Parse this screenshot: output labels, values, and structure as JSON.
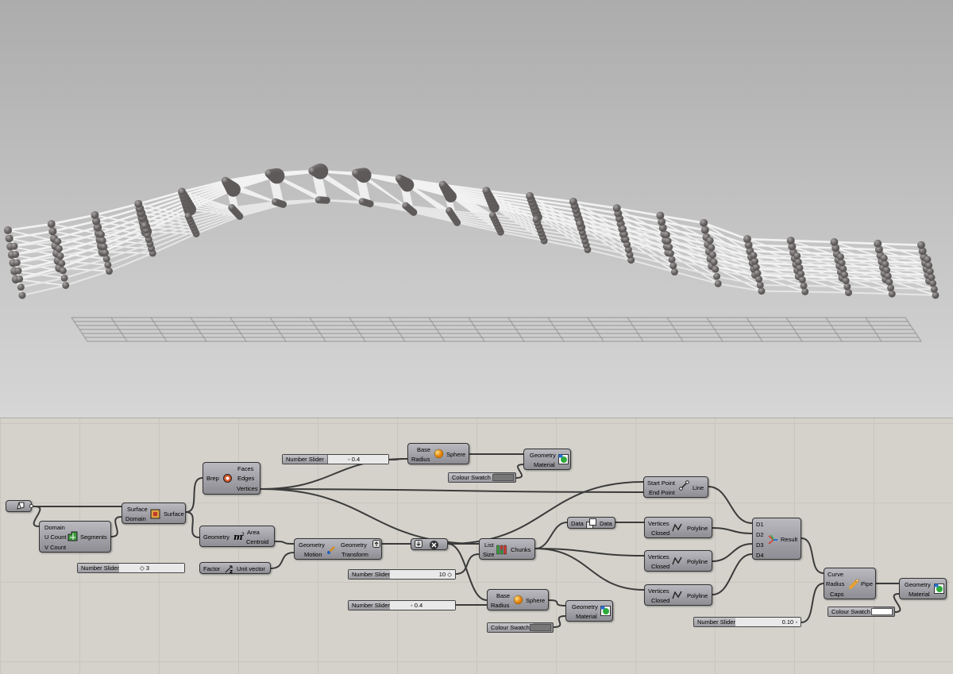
{
  "colors": {
    "wire": "#444444",
    "node_fill": "#a3a3a9",
    "sphere": "#7b7777",
    "pipe": "#f2f2f2"
  },
  "nodes": {
    "brep": {
      "in": [
        "Brep"
      ],
      "out": [
        "Faces",
        "Edges",
        "Vertices"
      ]
    },
    "surface": {
      "in": [
        "Surface",
        "Domain"
      ],
      "out": [
        "Surface"
      ]
    },
    "segments": {
      "in": [
        "Domain",
        "U Count",
        "V Count"
      ],
      "out": [
        "Segments"
      ]
    },
    "area": {
      "in": [
        "Geometry"
      ],
      "out": [
        "Area",
        "Centroid"
      ]
    },
    "unit_vector": {
      "in": [
        "Factor"
      ],
      "out": [
        "Unit vector"
      ]
    },
    "move": {
      "in": [
        "Geometry",
        "Motion"
      ],
      "out": [
        "Geometry",
        "Transform"
      ]
    },
    "sphere_top": {
      "in": [
        "Base",
        "Radius"
      ],
      "out": [
        "Sphere"
      ]
    },
    "sphere_bottom": {
      "in": [
        "Base",
        "Radius"
      ],
      "out": [
        "Sphere"
      ]
    },
    "preview_top": {
      "in": [
        "Geometry",
        "Material"
      ]
    },
    "preview_bottom": {
      "in": [
        "Geometry",
        "Material"
      ]
    },
    "preview_right": {
      "in": [
        "Geometry",
        "Material"
      ]
    },
    "line": {
      "in": [
        "Start Point",
        "End Point"
      ],
      "out": [
        "Line"
      ]
    },
    "chunks": {
      "in": [
        "List",
        "Size"
      ],
      "out": [
        "Chunks"
      ]
    },
    "data": {
      "in": [
        "Data"
      ],
      "out": [
        "Data"
      ]
    },
    "polyline1": {
      "in": [
        "Vertices",
        "Closed"
      ],
      "out": [
        "Polyline"
      ]
    },
    "polyline2": {
      "in": [
        "Vertices",
        "Closed"
      ],
      "out": [
        "Polyline"
      ]
    },
    "polyline3": {
      "in": [
        "Vertices",
        "Closed"
      ],
      "out": [
        "Polyline"
      ]
    },
    "merge": {
      "in": [
        "D1",
        "D2",
        "D3",
        "D4"
      ],
      "out": [
        "Result"
      ]
    },
    "pipe": {
      "in": [
        "Curve",
        "Radius",
        "Caps"
      ],
      "out": [
        "Pipe"
      ]
    }
  },
  "sliders": {
    "radius_top": {
      "name": "Number Slider",
      "value": "0.4"
    },
    "factor": {
      "name": "Number Slider",
      "value": "3"
    },
    "chunk_size": {
      "name": "Number Slider",
      "value": "10"
    },
    "radius_bottom": {
      "name": "Number Slider",
      "value": "0.4"
    },
    "pipe_radius": {
      "name": "Number Slider",
      "value": "0.10"
    }
  },
  "swatches": {
    "top": {
      "name": "Colour Swatch",
      "color": "#777777"
    },
    "bottom": {
      "name": "Colour Swatch",
      "color": "#777777"
    },
    "right": {
      "name": "Colour Swatch",
      "color": "#ffffff"
    }
  }
}
